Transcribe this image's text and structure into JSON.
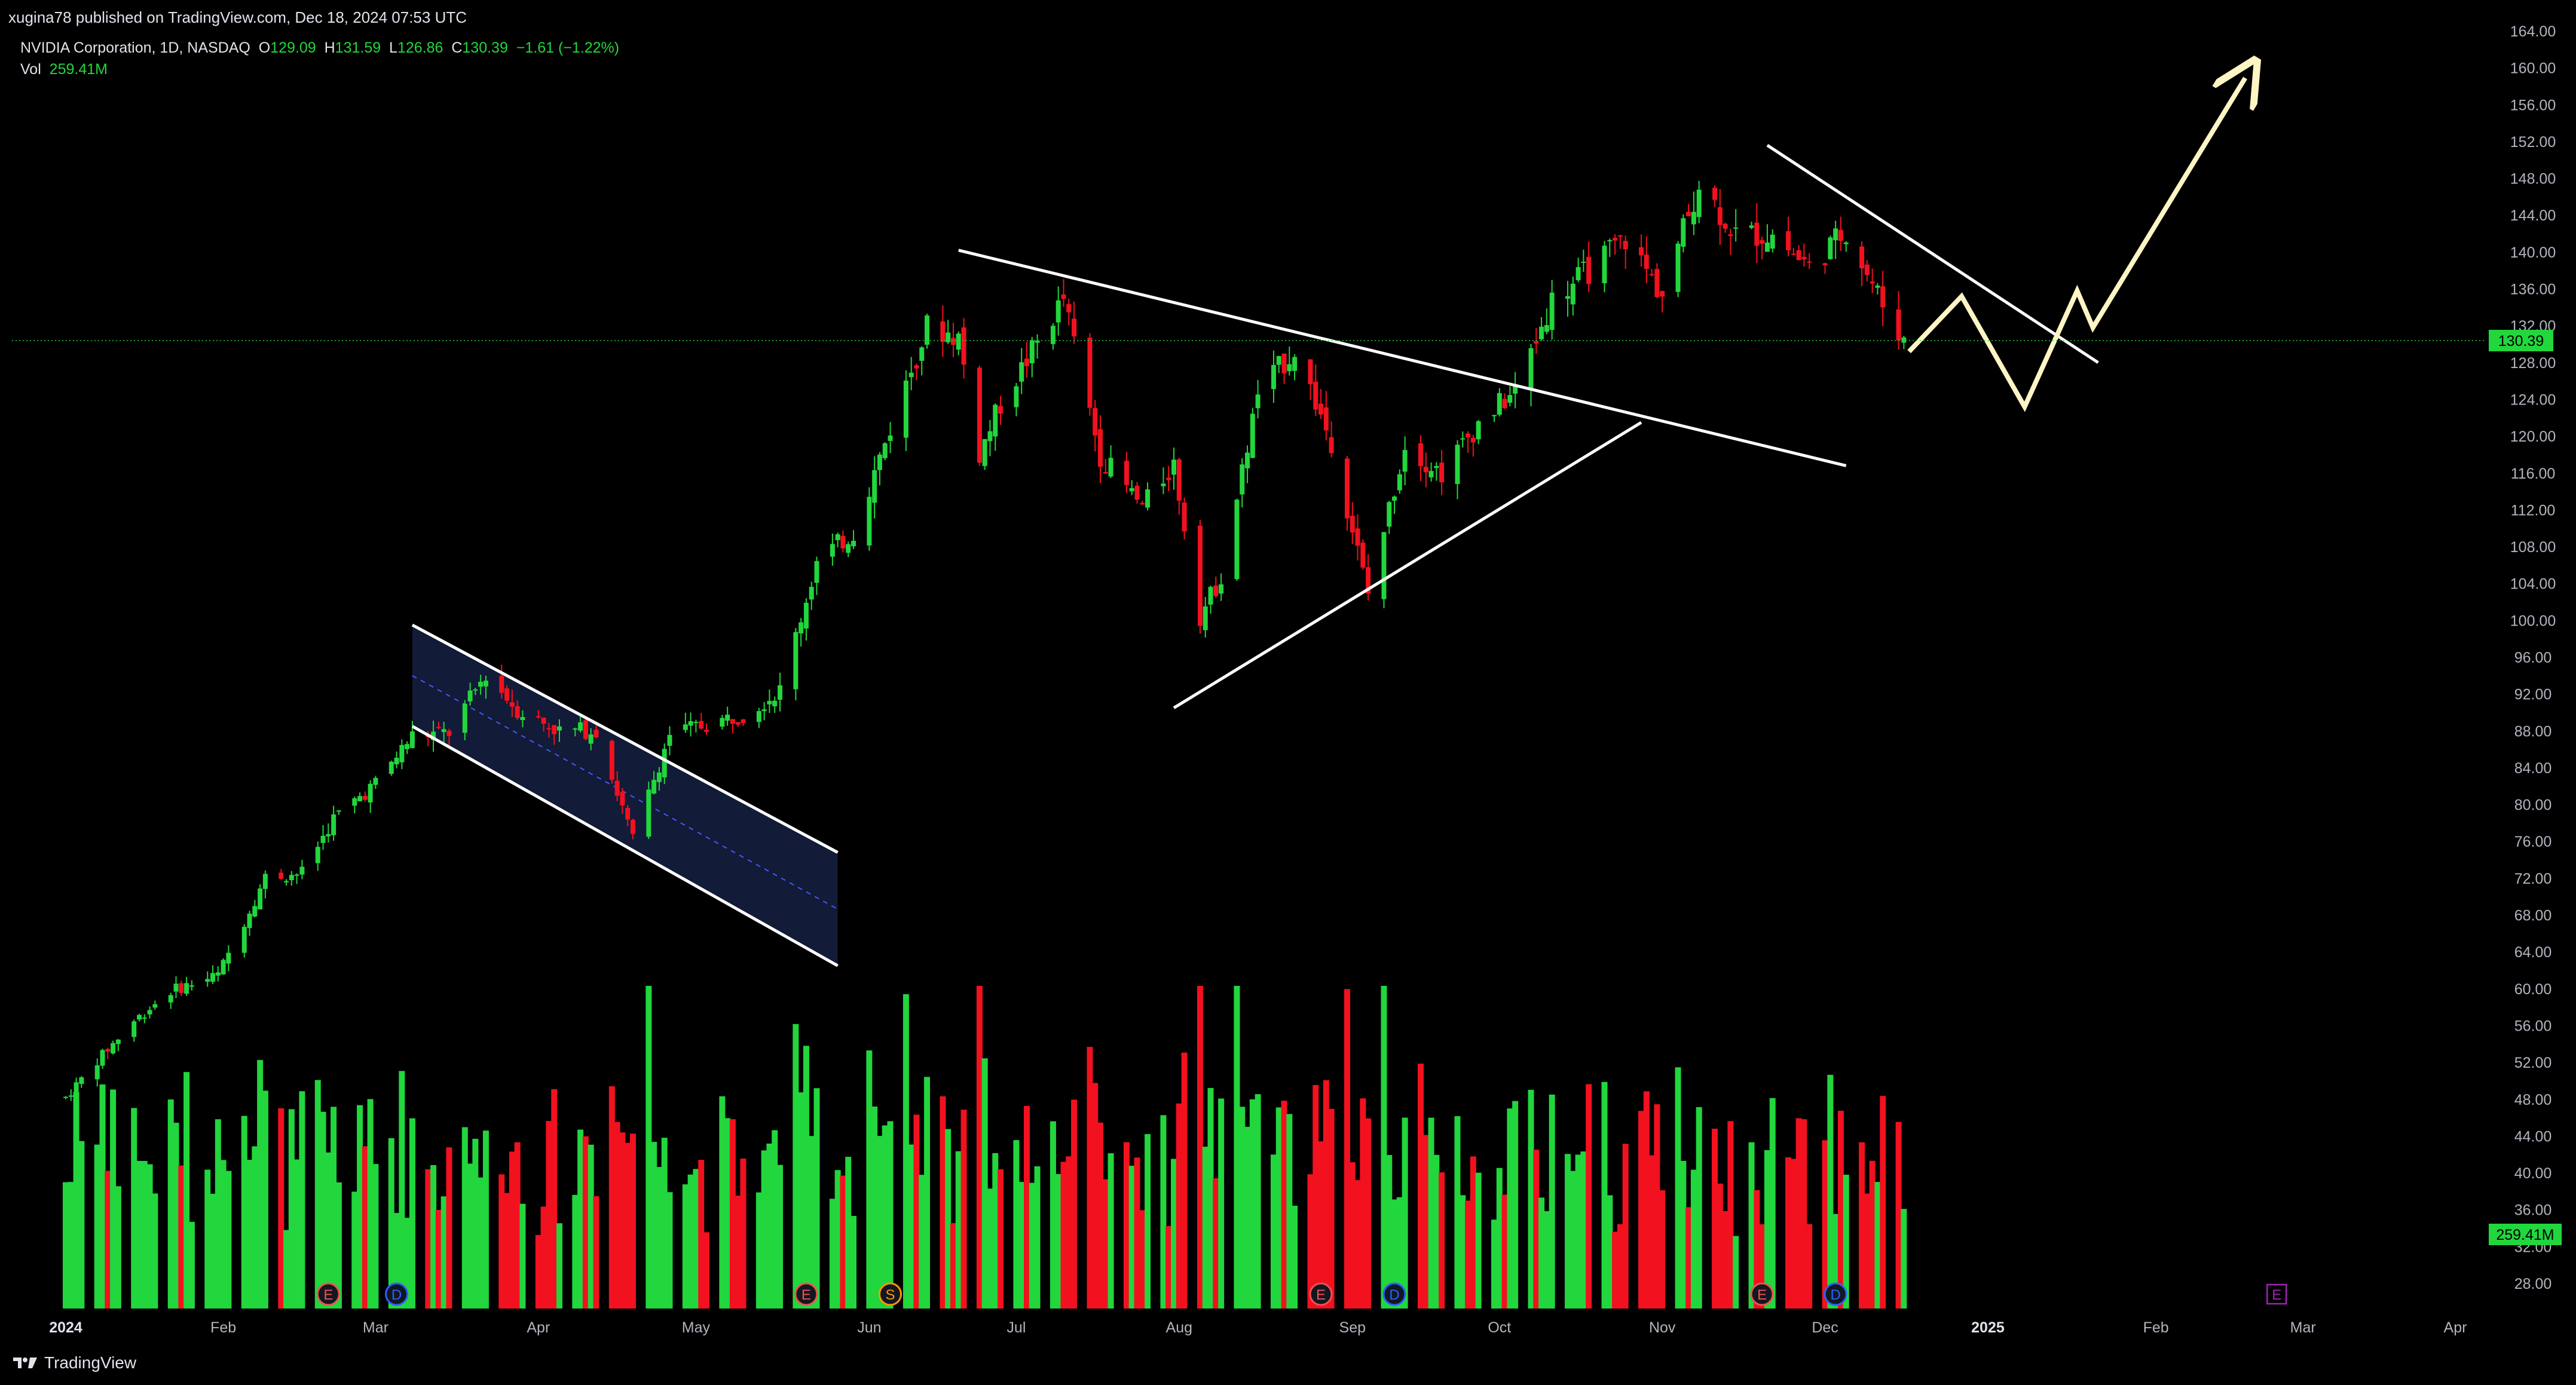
{
  "header": {
    "published": "xugina78 published on TradingView.com, Dec 18, 2024 07:53 UTC"
  },
  "legend": {
    "symbol": "NVIDIA Corporation, 1D, NASDAQ",
    "open_label": "O",
    "open": "129.09",
    "high_label": "H",
    "high": "131.59",
    "low_label": "L",
    "low": "126.86",
    "close_label": "C",
    "close": "130.39",
    "change": "−1.61 (−1.22%)",
    "vol_label": "Vol",
    "vol": "259.41M"
  },
  "footer": {
    "brand": "TradingView"
  },
  "colors": {
    "up": "#22d63d",
    "down": "#f2111f",
    "background": "#000000",
    "drawing": "#ffffff",
    "projection": "#fff5c4",
    "channel_fill": "#131c3a",
    "axis_text": "#b2b5be",
    "last_price_line": "#22d63d"
  },
  "chart_data": {
    "type": "candlestick",
    "symbol": "NVDA",
    "exchange": "NASDAQ",
    "interval": "1D",
    "y_ticks": [
      28,
      32,
      36,
      40,
      44,
      48,
      52,
      56,
      60,
      64,
      68,
      72,
      76,
      80,
      84,
      88,
      92,
      96,
      100,
      104,
      108,
      112,
      116,
      120,
      124,
      128,
      132,
      136,
      140,
      144,
      148,
      152,
      156,
      160,
      164
    ],
    "y_tick_labels": [
      "28.00",
      "32.00",
      "36.00",
      "40.00",
      "44.00",
      "48.00",
      "52.00",
      "56.00",
      "60.00",
      "64.00",
      "68.00",
      "72.00",
      "76.00",
      "80.00",
      "84.00",
      "88.00",
      "92.00",
      "96.00",
      "100.00",
      "104.00",
      "108.00",
      "112.00",
      "116.00",
      "120.00",
      "124.00",
      "128.00",
      "132.00",
      "136.00",
      "140.00",
      "144.00",
      "148.00",
      "152.00",
      "156.00",
      "160.00",
      "164.00"
    ],
    "ylim": [
      26,
      165
    ],
    "x_labels": [
      "2024",
      "Feb",
      "Mar",
      "Apr",
      "May",
      "Jun",
      "Jul",
      "Aug",
      "Sep",
      "Oct",
      "Nov",
      "Dec",
      "2025",
      "Feb",
      "Mar",
      "Apr"
    ],
    "x_label_dates": [
      "2024-01-02",
      "2024-02-01",
      "2024-03-01",
      "2024-04-01",
      "2024-05-01",
      "2024-06-03",
      "2024-07-01",
      "2024-08-01",
      "2024-09-03",
      "2024-10-01",
      "2024-11-01",
      "2024-12-02",
      "2025-01-02",
      "2025-02-03",
      "2025-03-03",
      "2025-04-01"
    ],
    "last_price": "130.39",
    "last_volume": "259.41M",
    "monthly_path": [
      {
        "date": "2024-01-02",
        "price": 48.2
      },
      {
        "date": "2024-01-08",
        "price": 52.2
      },
      {
        "date": "2024-01-15",
        "price": 56.5
      },
      {
        "date": "2024-01-22",
        "price": 59.8
      },
      {
        "date": "2024-01-31",
        "price": 61.5
      },
      {
        "date": "2024-02-09",
        "price": 72.1
      },
      {
        "date": "2024-02-16",
        "price": 72.6
      },
      {
        "date": "2024-02-22",
        "price": 78.5
      },
      {
        "date": "2024-03-01",
        "price": 82.3
      },
      {
        "date": "2024-03-08",
        "price": 87.5
      },
      {
        "date": "2024-03-15",
        "price": 87.8
      },
      {
        "date": "2024-03-22",
        "price": 94.2
      },
      {
        "date": "2024-03-28",
        "price": 90.3
      },
      {
        "date": "2024-04-05",
        "price": 88.0
      },
      {
        "date": "2024-04-12",
        "price": 88.1
      },
      {
        "date": "2024-04-19",
        "price": 76.2
      },
      {
        "date": "2024-04-26",
        "price": 87.7
      },
      {
        "date": "2024-05-03",
        "price": 88.7
      },
      {
        "date": "2024-05-10",
        "price": 89.8
      },
      {
        "date": "2024-05-17",
        "price": 92.4
      },
      {
        "date": "2024-05-24",
        "price": 106.3
      },
      {
        "date": "2024-05-31",
        "price": 109.6
      },
      {
        "date": "2024-06-07",
        "price": 120.9
      },
      {
        "date": "2024-06-14",
        "price": 131.9
      },
      {
        "date": "2024-06-20",
        "price": 130.8
      },
      {
        "date": "2024-06-24",
        "price": 118.1
      },
      {
        "date": "2024-06-28",
        "price": 123.5
      },
      {
        "date": "2024-07-10",
        "price": 134.9
      },
      {
        "date": "2024-07-17",
        "price": 117.9
      },
      {
        "date": "2024-07-25",
        "price": 112.3
      },
      {
        "date": "2024-07-31",
        "price": 117.0
      },
      {
        "date": "2024-08-05",
        "price": 100.5
      },
      {
        "date": "2024-08-09",
        "price": 104.8
      },
      {
        "date": "2024-08-16",
        "price": 124.6
      },
      {
        "date": "2024-08-23",
        "price": 129.4
      },
      {
        "date": "2024-08-30",
        "price": 119.4
      },
      {
        "date": "2024-09-06",
        "price": 102.8
      },
      {
        "date": "2024-09-13",
        "price": 119.1
      },
      {
        "date": "2024-09-20",
        "price": 116.0
      },
      {
        "date": "2024-09-27",
        "price": 121.4
      },
      {
        "date": "2024-10-04",
        "price": 124.9
      },
      {
        "date": "2024-10-11",
        "price": 134.8
      },
      {
        "date": "2024-10-18",
        "price": 138.0
      },
      {
        "date": "2024-10-25",
        "price": 141.5
      },
      {
        "date": "2024-11-01",
        "price": 135.4
      },
      {
        "date": "2024-11-08",
        "price": 147.6
      },
      {
        "date": "2024-11-15",
        "price": 141.9
      },
      {
        "date": "2024-11-22",
        "price": 141.9
      },
      {
        "date": "2024-11-29",
        "price": 138.3
      },
      {
        "date": "2024-12-06",
        "price": 142.4
      },
      {
        "date": "2024-12-13",
        "price": 134.3
      },
      {
        "date": "2024-12-17",
        "price": 130.4
      }
    ],
    "volume_ylim": [
      0,
      700
    ],
    "annotations": [
      {
        "type": "descending-channel",
        "from": "2024-03-08",
        "to": "2024-05-28",
        "upper": [
          99.5,
          74.8
        ],
        "lower": [
          88.5,
          62.5
        ]
      },
      {
        "type": "resistance-line",
        "from": "2024-06-20",
        "to": "2024-12-06",
        "prices": [
          140.2,
          116.8
        ]
      },
      {
        "type": "support-line",
        "from": "2024-07-31",
        "to": "2024-10-28",
        "prices": [
          90.5,
          121.5
        ]
      },
      {
        "type": "resistance-line",
        "from": "2024-11-21",
        "to": "2025-01-23",
        "prices": [
          151.6,
          128.0
        ]
      },
      {
        "type": "projection-arrow",
        "points": [
          [
            "2024-12-18",
            129.2
          ],
          [
            "2024-12-28",
            135.2
          ],
          [
            "2025-01-09",
            123.2
          ],
          [
            "2025-01-19",
            135.8
          ],
          [
            "2025-01-22",
            131.8
          ],
          [
            "2025-02-20",
            158.9
          ]
        ]
      }
    ],
    "event_markers": [
      {
        "date": "2024-02-21",
        "letter": "E"
      },
      {
        "date": "2024-03-05",
        "letter": "D"
      },
      {
        "date": "2024-05-22",
        "letter": "E"
      },
      {
        "date": "2024-06-07",
        "letter": "S"
      },
      {
        "date": "2024-08-28",
        "letter": "E"
      },
      {
        "date": "2024-09-11",
        "letter": "D"
      },
      {
        "date": "2024-11-20",
        "letter": "E"
      },
      {
        "date": "2024-12-04",
        "letter": "D"
      },
      {
        "date": "2025-02-26",
        "letter": "E"
      }
    ]
  }
}
